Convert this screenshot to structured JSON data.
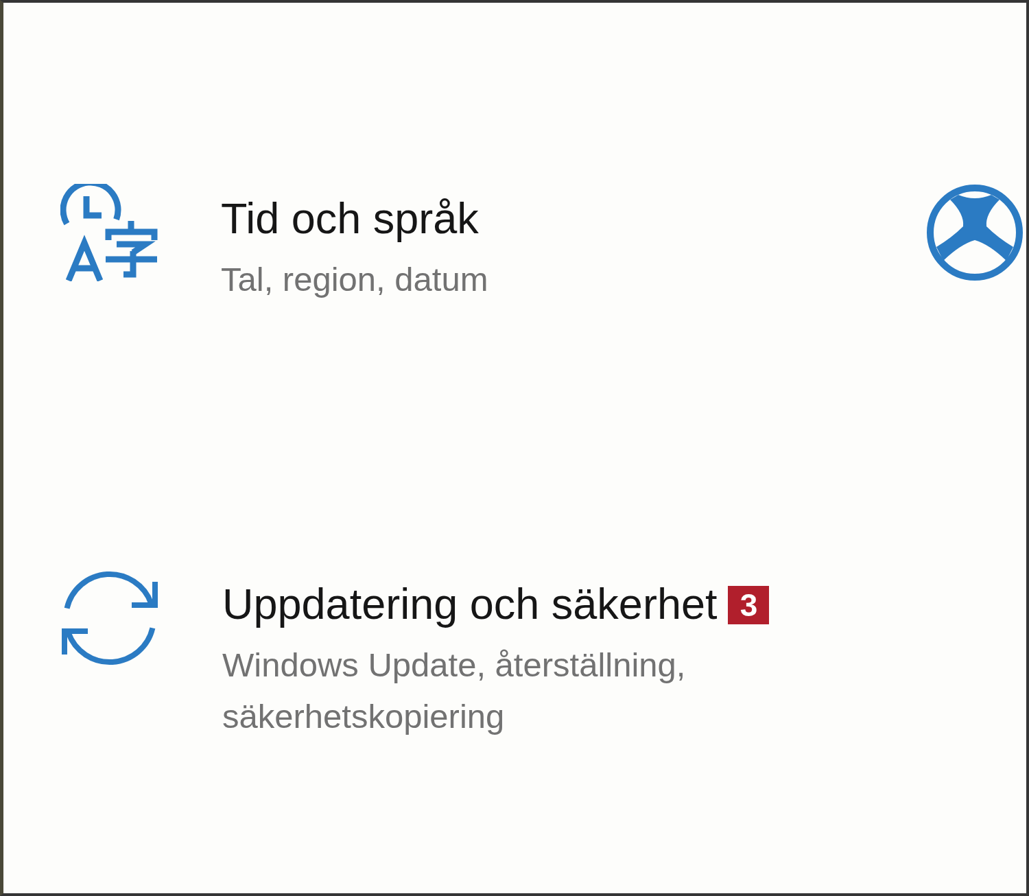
{
  "categories": [
    {
      "kind": "full",
      "title": "Tid och språk",
      "subtitle": "Tal, region, datum"
    },
    {
      "kind": "icon_only"
    },
    {
      "kind": "full",
      "title": "Uppdatering och säkerhet",
      "badge": "3",
      "subtitle": "Windows Update, återställning, säkerhetskopiering"
    }
  ]
}
